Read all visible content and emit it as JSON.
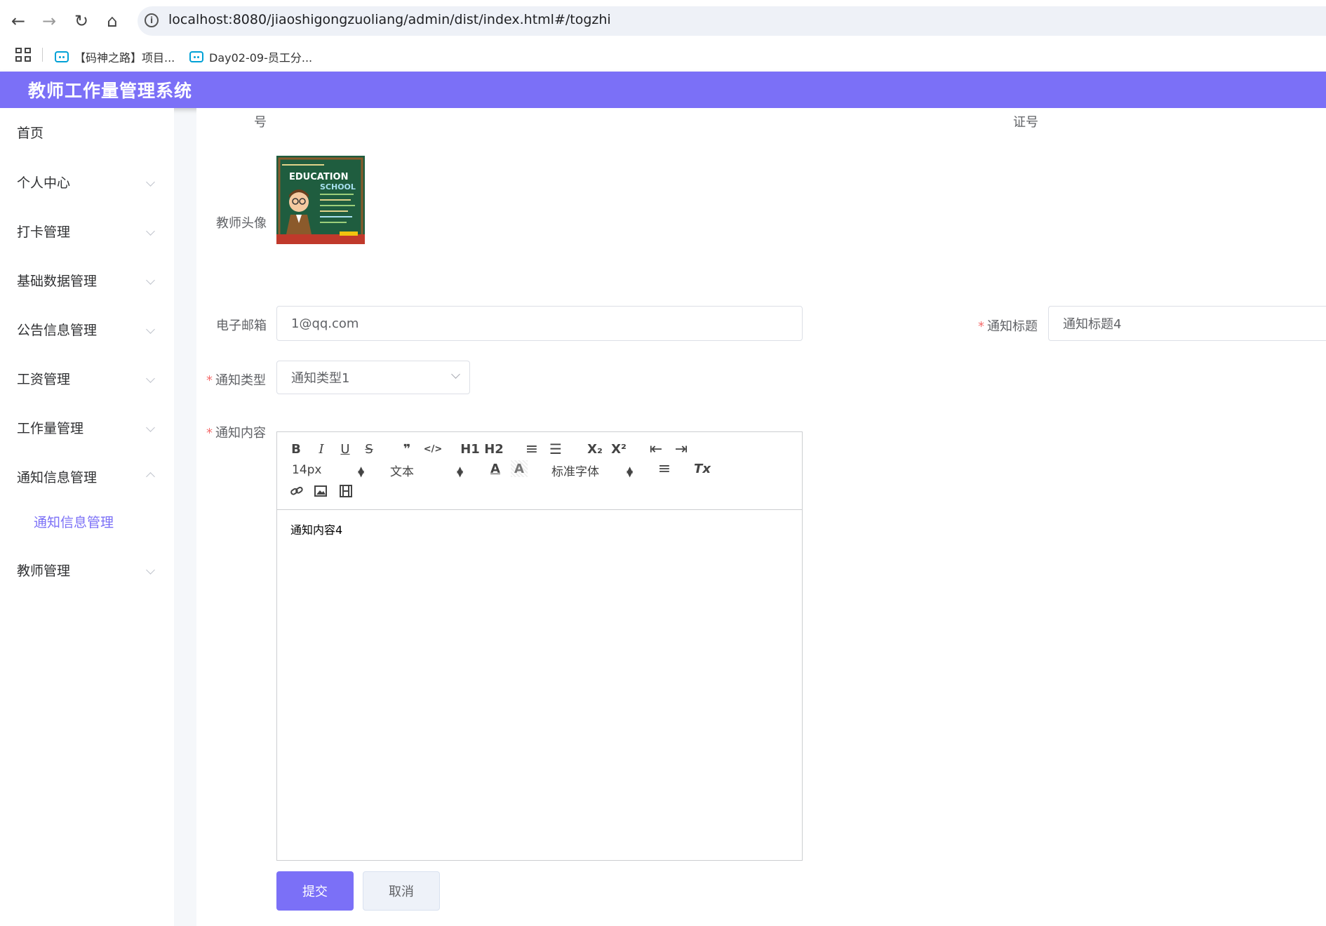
{
  "browser": {
    "url": "localhost:8080/jiaoshigongzuoliang/admin/dist/index.html#/togzhi",
    "bookmarks": [
      "【码神之路】项目...",
      "Day02-09-员工分..."
    ]
  },
  "app": {
    "title": "教师工作量管理系统"
  },
  "sidebar": {
    "items": [
      {
        "label": "首页"
      },
      {
        "label": "个人中心"
      },
      {
        "label": "打卡管理"
      },
      {
        "label": "基础数据管理"
      },
      {
        "label": "公告信息管理"
      },
      {
        "label": "工资管理"
      },
      {
        "label": "工作量管理"
      },
      {
        "label": "通知信息管理"
      },
      {
        "label": "教师管理"
      }
    ],
    "submenu_active": "通知信息管理",
    "accent_color": "#7b70f7"
  },
  "form": {
    "partial_label_left": "号",
    "partial_label_right": "证号",
    "avatar_label": "教师头像",
    "avatar_art": {
      "text": "EDUCATION",
      "text2": "SCHOOL"
    },
    "email_label": "电子邮箱",
    "email_value": "1@qq.com",
    "notice_title_label": "通知标题",
    "notice_title_value": "通知标题4",
    "notice_type_label": "通知类型",
    "notice_type_value": "通知类型1",
    "notice_content_label": "通知内容",
    "required_mark": "*"
  },
  "editor": {
    "toolbar": {
      "bold": "B",
      "italic": "I",
      "underline": "U",
      "strike": "S",
      "quote": "❞",
      "code": "</>",
      "h1": "H1",
      "h2": "H2",
      "ordered_list": "≡",
      "bullet_list": "☰",
      "subscript": "X₂",
      "superscript": "X²",
      "indent_dec": "⇤",
      "indent_inc": "⇥",
      "font_size": "14px",
      "header_style": "文本",
      "text_color": "A",
      "bg_color": "A",
      "font_family": "标准字体",
      "align": "≡",
      "clean": "Tx"
    },
    "content": "通知内容4"
  },
  "actions": {
    "submit": "提交",
    "cancel": "取消"
  }
}
